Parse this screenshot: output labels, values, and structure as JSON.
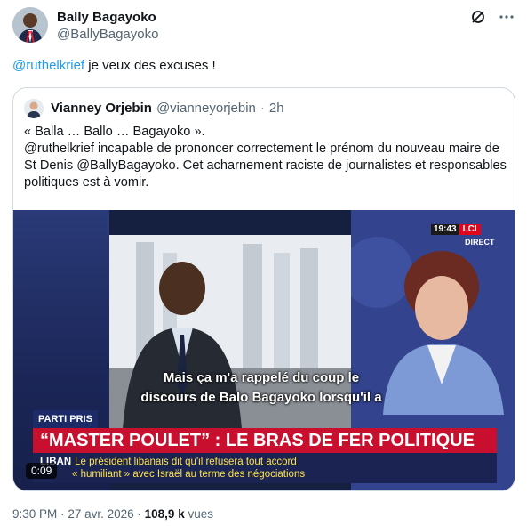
{
  "tweet": {
    "author_name": "Bally Bagayoko",
    "author_handle": "@BallyBagayoko",
    "mention": "@ruthelkrief",
    "text": " je veux des excuses !",
    "time": "9:30 PM",
    "separator": "·",
    "date": "27 avr. 2026",
    "views_count": "108,9 k",
    "views_label": "vues",
    "icons": [
      "grok-icon",
      "more-icon"
    ]
  },
  "quote": {
    "author_name": "Vianney Orjebin",
    "author_handle": "@vianneyorjebin",
    "separator": "·",
    "time_ago": "2h",
    "line1": "« Balla … Ballo … Bagayoko ».",
    "line2": "@ruthelkrief incapable de prononcer correctement le prénom du nouveau maire de St Denis @BallyBagayoko. Cet acharnement raciste de journalistes et responsables politiques est à vomir."
  },
  "video": {
    "clock_time": "19:43",
    "channel_logo": "LCI",
    "live_label": "DIRECT",
    "subtitle_line1": "Mais ça m'a rappelé du coup le",
    "subtitle_line2": "discours de Balo Bagayoko lorsqu'il a",
    "tag": "PARTI PRIS",
    "headline": "“MASTER POULET” : LE BRAS DE FER POLITIQUE",
    "ticker_tag": "LIBAN",
    "ticker_line1": "Le président libanais dit qu'il refusera tout accord",
    "ticker_line2": "« humiliant » avec Israël au terme des négociations",
    "duration": "0:09",
    "colors": {
      "headline_bg": "#c8102e",
      "ticker_bg": "#1a2352",
      "ticker_text": "#ffe14d"
    }
  },
  "colors": {
    "link": "#1d9bf0",
    "secondary_text": "#536471",
    "border": "#cfd9de"
  }
}
